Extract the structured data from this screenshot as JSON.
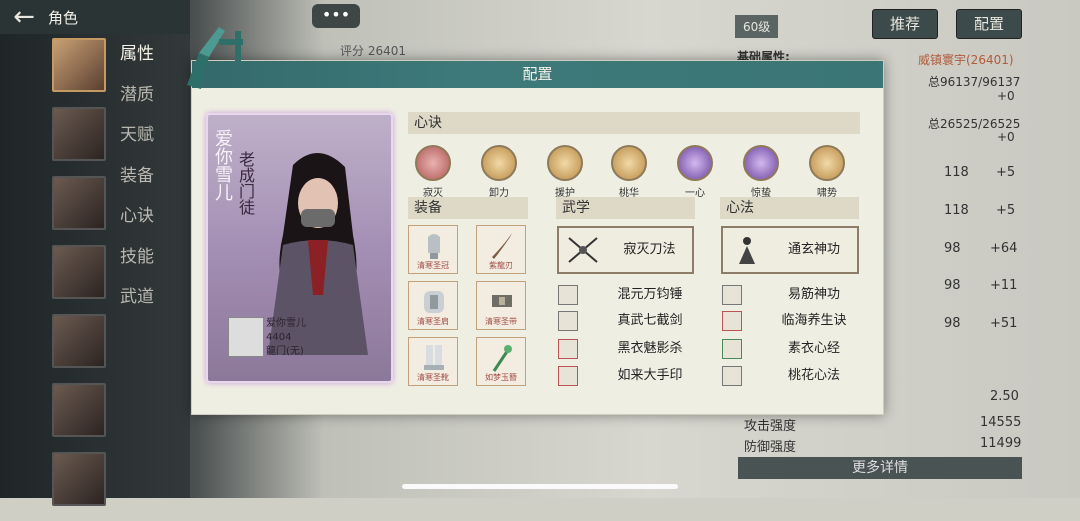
{
  "topbar": {
    "title": "角色"
  },
  "side_menu": [
    "属性",
    "潜质",
    "天赋",
    "装备",
    "心诀",
    "技能",
    "武道"
  ],
  "bubble": "•••",
  "score_label": "评分 26401",
  "level": "60级",
  "buttons": {
    "recommend": "推荐",
    "config": "配置"
  },
  "right_panel": {
    "basic_attr_label": "基础属性:",
    "title_red": "威镇寰宇(26401)",
    "hp": "总96137/96137",
    "hp_plus": "+0",
    "mp": "总26525/26525",
    "mp_plus": "+0",
    "stats": [
      {
        "v": "118",
        "plus": "+5"
      },
      {
        "v": "118",
        "plus": "+5"
      },
      {
        "v": "98",
        "plus": "+64"
      },
      {
        "v": "98",
        "plus": "+11"
      },
      {
        "v": "98",
        "plus": "+51"
      }
    ],
    "bottom_stats": [
      {
        "label": "",
        "value": "2.50"
      },
      {
        "label": "攻击强度",
        "value": "14555"
      },
      {
        "label": "防御强度",
        "value": "11499"
      }
    ],
    "more_button": "更多详情"
  },
  "modal": {
    "title": "配置",
    "card": {
      "name_vertical": "爱你雪儿",
      "title_vertical": "老成门徒",
      "player_name": "爱你雪儿",
      "player_id": "4404",
      "guild": "龍门(无)"
    },
    "xinjue_header": "心诀",
    "xinjue": [
      "寂灭",
      "卸力",
      "援护",
      "桃华",
      "一心",
      "惊蛰",
      "啸势"
    ],
    "equip_header": "装备",
    "equip": [
      "清寒圣冠",
      "紫龍刃",
      "清寒圣肩",
      "清寒圣带",
      "清寒圣靴",
      "如梦玉簪"
    ],
    "wuxue_header": "武学",
    "wuxue_main": "寂灭刀法",
    "wuxue_list": [
      "混元万钧锤",
      "真武七截剑",
      "黑衣魅影杀",
      "如来大手印"
    ],
    "xinfa_header": "心法",
    "xinfa_main": "通玄神功",
    "xinfa_list": [
      "易筋神功",
      "临海养生诀",
      "素衣心经",
      "桃花心法"
    ]
  },
  "colors": {
    "header": "#3e7a7b",
    "panel": "#efeee3",
    "accent_red": "#b05b3b"
  }
}
